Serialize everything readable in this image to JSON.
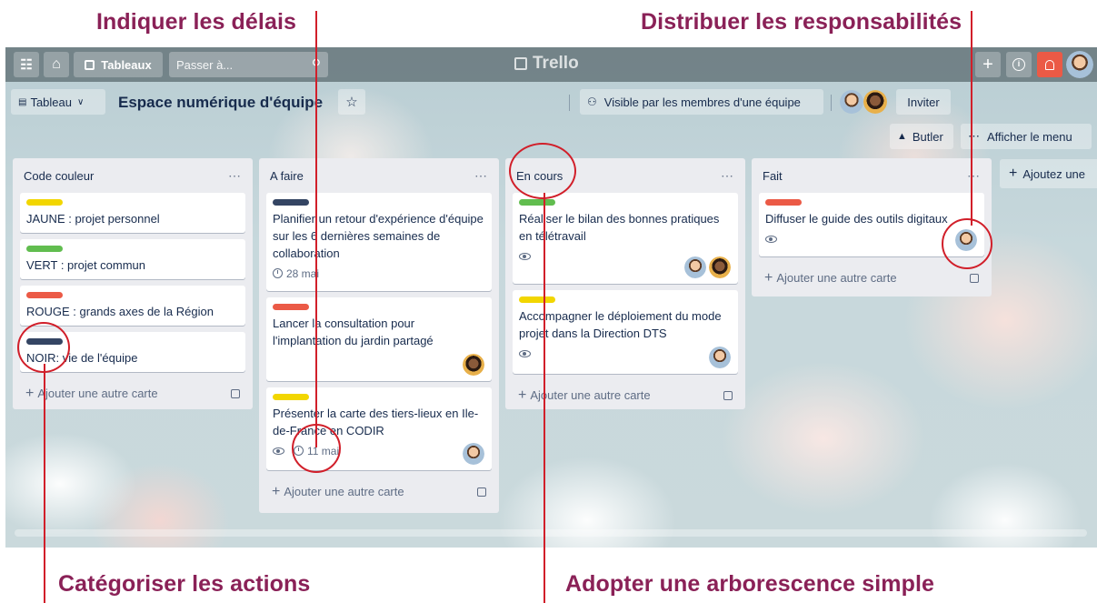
{
  "annotations": {
    "delais": "Indiquer les délais",
    "responsabilites": "Distribuer les responsabilités",
    "categoriser": "Catégoriser les actions",
    "arborescence": "Adopter une arborescence simple"
  },
  "topbar": {
    "apps_icon": "grid-icon",
    "home_icon": "home-icon",
    "boards_label": "Tableaux",
    "search_placeholder": "Passer à...",
    "logo": "Trello",
    "add_icon": "plus-icon",
    "info_icon": "info-icon",
    "notification_icon": "bell-icon"
  },
  "board_header": {
    "view_label": "Tableau",
    "title": "Espace numérique d'équipe",
    "star_icon": "star-icon",
    "visibility_label": "Visible par les membres d'une équipe",
    "invite_label": "Inviter",
    "butler_label": "Butler",
    "menu_label": "Afficher le menu"
  },
  "colors": {
    "yellow": "#f2d600",
    "green": "#61bd4f",
    "red": "#eb5a46",
    "black": "#344563",
    "annotation": "#8a2157",
    "highlight": "#d11f2a"
  },
  "lists": [
    {
      "title": "Code couleur",
      "cards": [
        {
          "label_color": "#f2d600",
          "text": "JAUNE : projet personnel"
        },
        {
          "label_color": "#61bd4f",
          "text": "VERT : projet commun"
        },
        {
          "label_color": "#eb5a46",
          "text": "ROUGE : grands axes de la Région"
        },
        {
          "label_color": "#344563",
          "text": "NOIR: vie de l'équipe"
        }
      ],
      "add_label": "Ajouter une autre carte"
    },
    {
      "title": "A faire",
      "cards": [
        {
          "label_color": "#344563",
          "text": "Planifier un retour d'expérience d'équipe sur les 6 dernières semaines de collaboration",
          "due": "28 mai"
        },
        {
          "label_color": "#eb5a46",
          "text": "Lancer la consultation pour l'implantation du jardin partagé"
        },
        {
          "label_color": "#f2d600",
          "text": "Présenter la carte des tiers-lieux en Ile-de-France en CODIR",
          "due": "11 mai"
        }
      ],
      "add_label": "Ajouter une autre carte"
    },
    {
      "title": "En cours",
      "cards": [
        {
          "label_color": "#61bd4f",
          "text": "Réaliser le bilan des bonnes pratiques en télétravail"
        },
        {
          "label_color": "#f2d600",
          "text": "Accompagner le déploiement du mode projet dans la Direction DTS"
        }
      ],
      "add_label": "Ajouter une autre carte"
    },
    {
      "title": "Fait",
      "cards": [
        {
          "label_color": "#eb5a46",
          "text": "Diffuser le guide des outils digitaux"
        }
      ],
      "add_label": "Ajouter une autre carte"
    }
  ],
  "add_list_label": "Ajoutez une"
}
